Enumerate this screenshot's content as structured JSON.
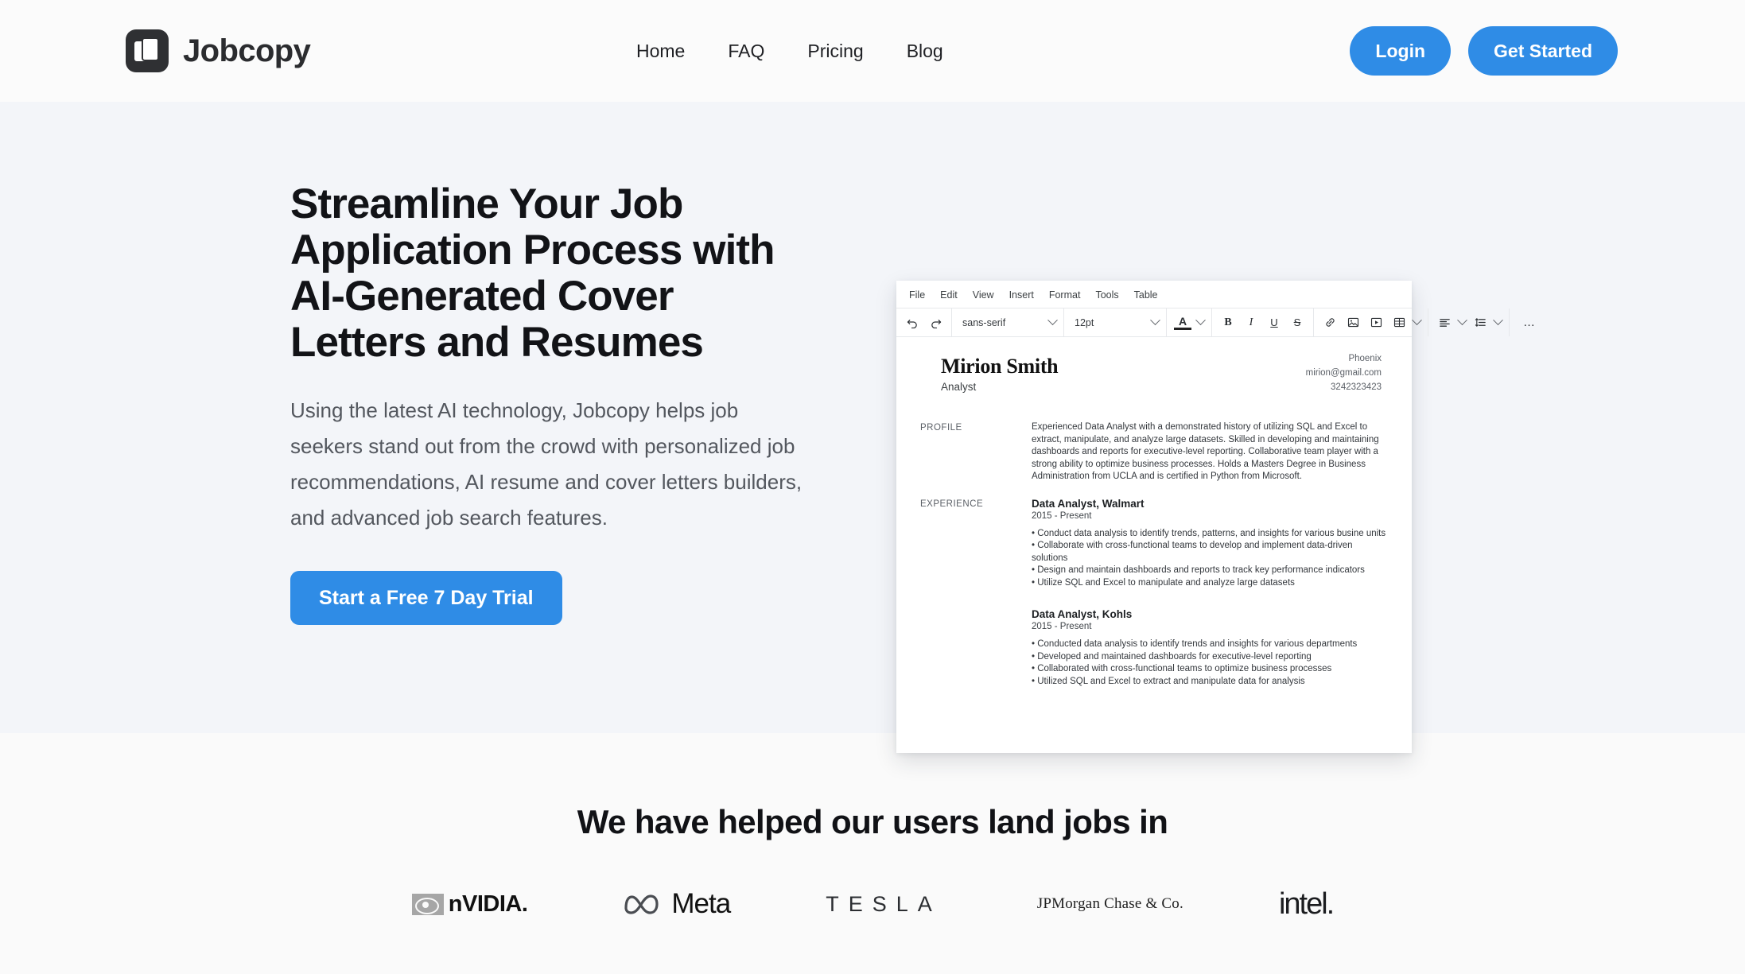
{
  "brand": {
    "name": "Jobcopy",
    "logo_icon": "documents-stack-icon"
  },
  "nav": {
    "items": [
      {
        "label": "Home"
      },
      {
        "label": "FAQ"
      },
      {
        "label": "Pricing"
      },
      {
        "label": "Blog"
      }
    ]
  },
  "header_actions": {
    "login_label": "Login",
    "get_started_label": "Get Started",
    "accent_color": "#2f8ce6"
  },
  "hero": {
    "title": "Streamline Your Job Application Process with AI-Generated Cover Letters and Resumes",
    "subtitle": "Using the latest AI technology, Jobcopy helps job seekers stand out from the crowd with personalized job recommendations, AI resume and cover letters builders, and advanced job search features.",
    "cta_label": "Start a Free 7 Day Trial",
    "background_color": "#f3f5f9"
  },
  "editor": {
    "menubar": [
      "File",
      "Edit",
      "View",
      "Insert",
      "Format",
      "Tools",
      "Table"
    ],
    "toolbar": {
      "undo_icon": "undo-icon",
      "redo_icon": "redo-icon",
      "font_family_value": "sans-serif",
      "font_size_value": "12pt",
      "text_color_icon": "text-color-A-icon",
      "bold_label": "B",
      "italic_label": "I",
      "underline_label": "U",
      "strikethrough_label": "S",
      "link_icon": "link-icon",
      "image_icon": "image-icon",
      "media_icon": "media-play-icon",
      "table_icon": "table-icon",
      "align_icon": "align-left-icon",
      "line_height_icon": "line-height-icon",
      "more_label": "…"
    },
    "resume": {
      "name": "Mirion Smith",
      "role": "Analyst",
      "contact": {
        "location": "Phoenix",
        "email": "mirion@gmail.com",
        "phone": "3242323423"
      },
      "sections": [
        {
          "label": "PROFILE",
          "paragraph": "Experienced Data Analyst with a demonstrated history of utilizing SQL and Excel to extract, manipulate, and analyze large datasets. Skilled in developing and maintaining dashboards and reports for executive-level reporting. Collaborative team player with a strong ability to optimize business processes. Holds a Masters Degree in Business Administration from UCLA and is certified in Python from Microsoft."
        }
      ],
      "experience_label": "EXPERIENCE",
      "jobs": [
        {
          "title": "Data Analyst, Walmart",
          "dates": "2015 - Present",
          "bullets": [
            "• Conduct data analysis to identify trends, patterns, and insights for various busine units",
            "• Collaborate with cross-functional teams to develop and implement data-driven solutions",
            "• Design and maintain dashboards and reports to track key performance indicators",
            "• Utilize SQL and Excel to manipulate and analyze large datasets"
          ]
        },
        {
          "title": "Data Analyst, Kohls",
          "dates": "2015 - Present",
          "bullets": [
            "• Conducted data analysis to identify trends and insights for various departments",
            "• Developed and maintained dashboards for executive-level reporting",
            "• Collaborated with cross-functional teams to optimize business processes",
            "• Utilized SQL and Excel to extract and manipulate data for analysis"
          ]
        }
      ]
    }
  },
  "logos_section": {
    "title": "We have helped our users land jobs in",
    "logos": [
      {
        "name": "NVIDIA",
        "text": "nVIDIA."
      },
      {
        "name": "Meta",
        "text": "Meta"
      },
      {
        "name": "Tesla",
        "text": "TESLA"
      },
      {
        "name": "JPMorgan Chase & Co.",
        "text": "JPMorgan Chase & Co."
      },
      {
        "name": "Intel",
        "text": "intel."
      }
    ]
  }
}
